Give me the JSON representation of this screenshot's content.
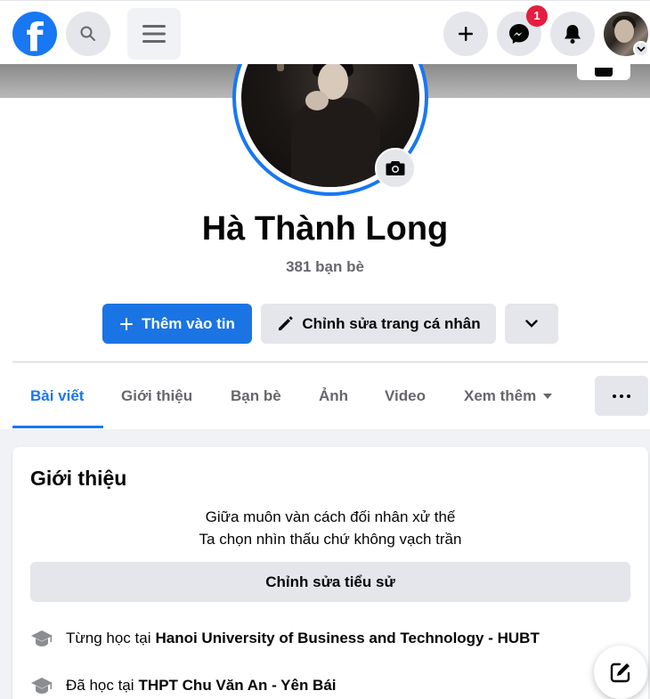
{
  "header": {
    "logo_icon": "facebook-logo-icon",
    "search_icon": "search-icon",
    "menu_icon": "hamburger-menu-icon",
    "create_icon": "plus-icon",
    "messenger_icon": "messenger-icon",
    "messenger_badge": "1",
    "notifications_icon": "bell-icon"
  },
  "profile": {
    "name": "Hà Thành Long",
    "friends_count": "381 bạn bè"
  },
  "actions": {
    "add_story": "Thêm vào tin",
    "edit_profile": "Chỉnh sửa trang cá nhân"
  },
  "tabs": [
    {
      "label": "Bài viết",
      "active": true
    },
    {
      "label": "Giới thiệu",
      "active": false
    },
    {
      "label": "Bạn bè",
      "active": false
    },
    {
      "label": "Ảnh",
      "active": false
    },
    {
      "label": "Video",
      "active": false
    },
    {
      "label": "Xem thêm",
      "active": false
    }
  ],
  "intro": {
    "title": "Giới thiệu",
    "bio_line1": "Giữa muôn vàn cách đối nhân xử thế",
    "bio_line2": "Ta chọn nhìn thấu chứ không vạch trần",
    "edit_bio": "Chỉnh sửa tiểu sử",
    "education": [
      {
        "prefix": "Từng học tại",
        "school": "Hanoi University of Business and Technology - HUBT"
      },
      {
        "prefix": "Đã học tại",
        "school": "THPT Chu Văn An - Yên Bái"
      }
    ]
  },
  "colors": {
    "brand": "#1877f2",
    "badge": "#e41e3f",
    "button_gray": "#e4e6eb",
    "page_gray": "#f0f2f5"
  }
}
